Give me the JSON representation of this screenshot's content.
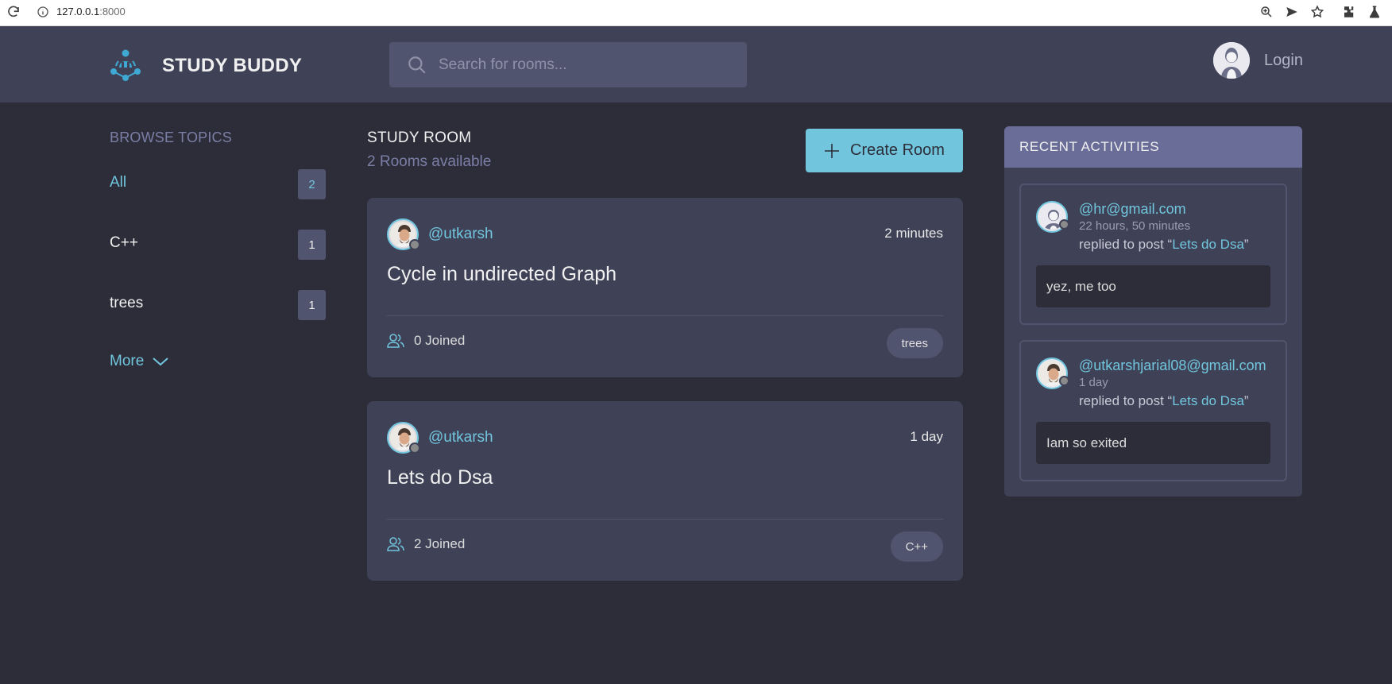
{
  "browser": {
    "url_host": "127.0.0.1",
    "url_port": ":8000"
  },
  "header": {
    "brand": "STUDY BUDDY",
    "search_placeholder": "Search for rooms...",
    "login_label": "Login"
  },
  "sidebar": {
    "title": "BROWSE TOPICS",
    "topics": [
      {
        "label": "All",
        "count": "2",
        "active": true
      },
      {
        "label": "C++",
        "count": "1",
        "active": false
      },
      {
        "label": "trees",
        "count": "1",
        "active": false
      }
    ],
    "more_label": "More"
  },
  "main": {
    "title": "STUDY ROOM",
    "subtitle": "2 Rooms available",
    "create_label": "Create Room",
    "rooms": [
      {
        "host": "@utkarsh",
        "time": "2 minutes",
        "name": "Cycle in undirected Graph",
        "joined": "0 Joined",
        "topic": "trees"
      },
      {
        "host": "@utkarsh",
        "time": "1 day",
        "name": "Lets do Dsa",
        "joined": "2 Joined",
        "topic": "C++"
      }
    ]
  },
  "activities": {
    "title": "RECENT ACTIVITIES",
    "items": [
      {
        "user": "@hr@gmail.com",
        "ago": "22 hours, 50 minutes",
        "action_prefix": "replied to post “",
        "post": "Lets do Dsa",
        "action_suffix": "”",
        "message": "yez, me too"
      },
      {
        "user": "@utkarshjarial08@gmail.com",
        "ago": "1 day",
        "action_prefix": "replied to post “",
        "post": "Lets do Dsa",
        "action_suffix": "”",
        "message": "Iam so exited"
      }
    ]
  },
  "colors": {
    "accent": "#71c6dd",
    "background": "#2d2d39",
    "surface": "#3f4156",
    "header_panel": "#696d97"
  }
}
